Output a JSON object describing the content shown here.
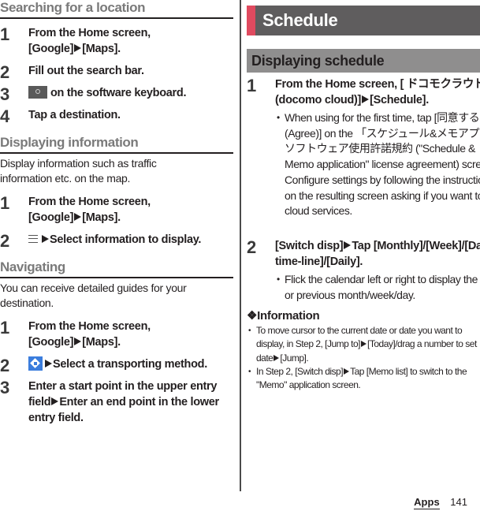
{
  "left": {
    "searching": {
      "heading": "Searching for a location",
      "steps": [
        {
          "num": "1",
          "line1": "From the Home screen,",
          "line2a": "[Google]",
          "line2b": "[Maps]."
        },
        {
          "num": "2",
          "text": "Fill out the search bar."
        },
        {
          "num": "3",
          "icon": "keyboard-search-icon",
          "text": "on the software keyboard."
        },
        {
          "num": "4",
          "text": "Tap a destination."
        }
      ]
    },
    "displaying": {
      "heading": "Displaying information",
      "intro": "Display information such as traffic information etc. on the map.",
      "steps": [
        {
          "num": "1",
          "line1": "From the Home screen,",
          "line2a": "[Google]",
          "line2b": "[Maps]."
        },
        {
          "num": "2",
          "icon": "menu-icon",
          "text": "Select information to display."
        }
      ]
    },
    "navigating": {
      "heading": "Navigating",
      "intro": "You can receive detailed guides for your destination.",
      "steps": [
        {
          "num": "1",
          "line1": "From the Home screen,",
          "line2a": "[Google]",
          "line2b": "[Maps]."
        },
        {
          "num": "2",
          "icon": "directions-icon",
          "text": "Select a transporting method."
        },
        {
          "num": "3",
          "text_a": "Enter a start point in the upper entry field",
          "text_b": "Enter an end point in the lower entry field."
        }
      ]
    }
  },
  "right": {
    "chapter_title": "Schedule",
    "section_title": "Displaying schedule",
    "steps": [
      {
        "num": "1",
        "text_a": "From the Home screen, [ ドコモクラウド (docomo cloud)]",
        "text_b": "[Schedule].",
        "note": "When using for the first time, tap [同意する (Agree)] on the 「スケジュール&メモアプリ」ソフトウェア使用許諾規約 (\"Schedule & Memo application\" license agreement) screen. Configure settings by following the instructions on the resulting screen asking if you want to use cloud services."
      },
      {
        "num": "2",
        "text_a": "[Switch disp]",
        "text_b": "Tap [Monthly]/[Week]/[Daily time-line]/[Daily].",
        "note": "Flick the calendar left or right to display the next or previous month/week/day."
      }
    ],
    "information": {
      "heading": "❖Information",
      "items": [
        {
          "a": "To move cursor to the current date or date you want to display, in Step 2, [Jump to]",
          "b": "[Today]/drag a number to set date",
          "c": "[Jump]."
        },
        {
          "a": "In Step 2, [Switch disp]",
          "b": "Tap [Memo list] to switch to the \"Memo\" application screen."
        }
      ]
    }
  },
  "footer": {
    "section": "Apps",
    "page": "141"
  },
  "colors": {
    "chapter_bar": "#5f5d5e",
    "chapter_accent": "#e04a5f",
    "section_bar": "#8f8e8e",
    "heading_gray": "#7a7a7a",
    "directions_icon": "#3b7ddd"
  }
}
